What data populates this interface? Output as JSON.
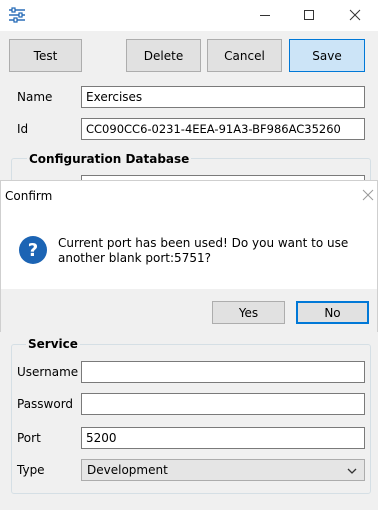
{
  "main_window": {
    "toolbar": {
      "test_label": "Test",
      "delete_label": "Delete",
      "cancel_label": "Cancel",
      "save_label": "Save"
    },
    "fields": {
      "name_label": "Name",
      "name_value": "Exercises",
      "id_label": "Id",
      "id_value": "CC090CC6-0231-4EEA-91A3-BF986AC35260"
    },
    "configuration_db_title": "Configuration Database",
    "service": {
      "title": "Service",
      "username_label": "Username",
      "username_value": "",
      "password_label": "Password",
      "password_value": "",
      "port_label": "Port",
      "port_value": "5200",
      "type_label": "Type",
      "type_value": "Development"
    }
  },
  "dialog": {
    "title": "Confirm",
    "message": "Current port has been used! Do you want to use another blank port:5751?",
    "yes_label": "Yes",
    "no_label": "No"
  },
  "icons": {
    "app": "sliders-icon",
    "minimize": "minimize-icon",
    "maximize": "maximize-icon",
    "close": "close-icon",
    "question": "question-icon",
    "dialog_close": "close-icon"
  },
  "colors": {
    "accent": "#0078d7",
    "primary_button_bg": "#cce4f7",
    "question_icon": "#1c64b4"
  }
}
